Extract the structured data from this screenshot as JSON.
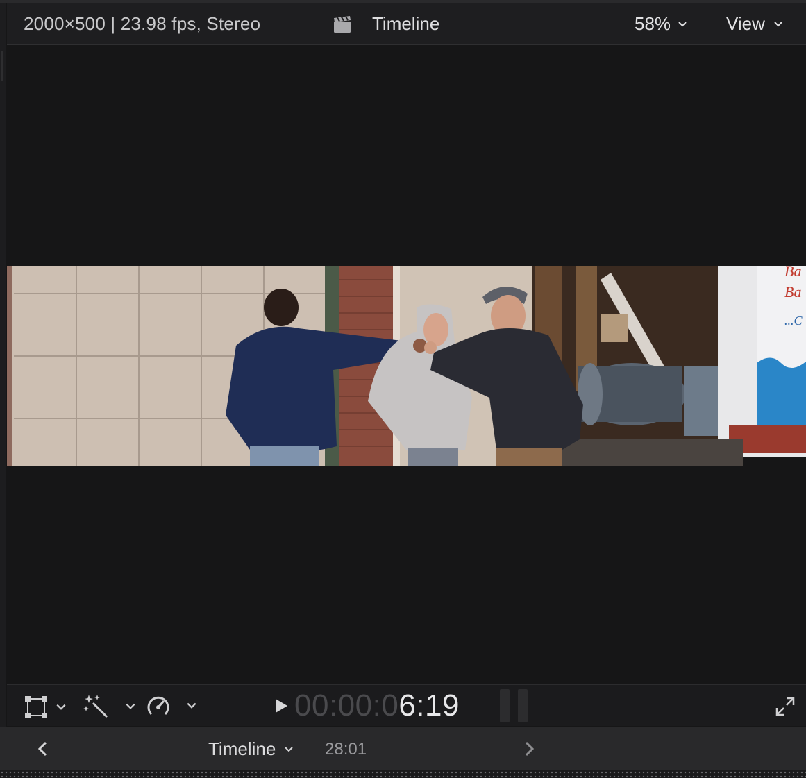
{
  "header": {
    "format_info": "2000×500 | 23.98 fps, Stereo",
    "title": "Timeline",
    "zoom_label": "58%",
    "view_label": "View",
    "clapper_icon": "clapperboard-icon"
  },
  "toolbar": {
    "transform_icon": "transform-crop-icon",
    "enhance_icon": "magic-wand-icon",
    "retime_icon": "speedometer-icon",
    "timecode_dim": "00:00:0",
    "timecode_bright": "6:19",
    "play_icon": "play-icon",
    "fullscreen_icon": "expand-icon"
  },
  "bottom_bar": {
    "title": "Timeline",
    "duration": "28:01",
    "back_icon": "chevron-left-icon",
    "forward_icon": "chevron-right-icon"
  },
  "colors": {
    "background": "#161617",
    "panel": "#1e1e20",
    "bottom_bar": "#29292b",
    "text": "#e6e6e6",
    "timecode_dim": "#4a4a4d"
  }
}
